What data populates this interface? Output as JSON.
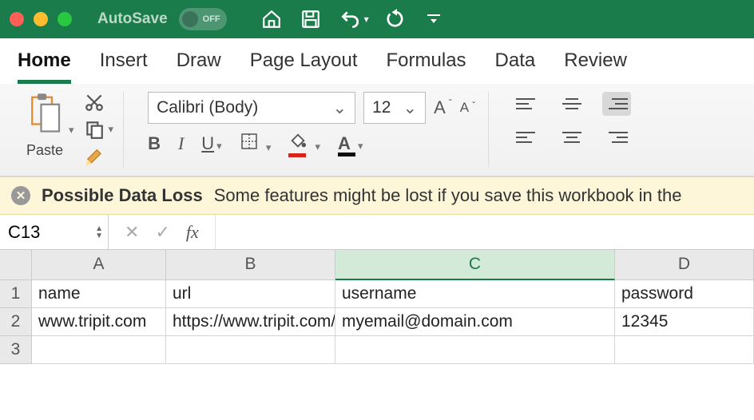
{
  "titlebar": {
    "autosave_label": "AutoSave",
    "autosave_state": "OFF"
  },
  "tabs": [
    "Home",
    "Insert",
    "Draw",
    "Page Layout",
    "Formulas",
    "Data",
    "Review"
  ],
  "active_tab": "Home",
  "ribbon": {
    "paste_label": "Paste",
    "font_name": "Calibri (Body)",
    "font_size": "12",
    "bold": "B",
    "italic": "I",
    "underline": "U",
    "font_grow": "A",
    "font_shrink": "A",
    "font_color_letter": "A"
  },
  "warning": {
    "title": "Possible Data Loss",
    "message": "Some features might be lost if you save this workbook in the"
  },
  "namebox": "C13",
  "fx_label": "fx",
  "formula_value": "",
  "columns": [
    "A",
    "B",
    "C",
    "D"
  ],
  "selected_column": "C",
  "rows": [
    {
      "n": "1",
      "cells": [
        "name",
        "url",
        "username",
        "password"
      ]
    },
    {
      "n": "2",
      "cells": [
        "www.tripit.com",
        "https://www.tripit.com/",
        "myemail@domain.com",
        "12345"
      ]
    },
    {
      "n": "3",
      "cells": [
        "",
        "",
        "",
        ""
      ]
    }
  ],
  "colors": {
    "accent": "#1a7c4a",
    "fill_indicator": "#ffd400",
    "font_color_indicator": "#d8231b"
  }
}
